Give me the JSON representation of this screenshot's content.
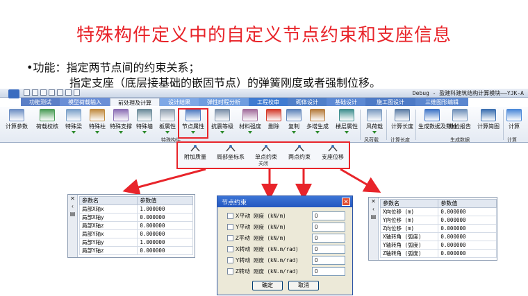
{
  "slide": {
    "title": "特殊构件定义中的自定义节点约束和支座信息",
    "bullet1": "•功能：指定两节点间的约束关系；",
    "bullet2": "指定支座（底层接基础的嵌固节点）的弹簧刚度或者强制位移。"
  },
  "app": {
    "title": "Debug - 盈建科建筑结构计算模块——YJK-A",
    "tabs": [
      {
        "label": "功能测试",
        "color": "#5b7fc7"
      },
      {
        "label": "模型荷载输入",
        "color": "#6b8fd6"
      },
      {
        "label": "前处理及计算",
        "color": "#f2f5fa",
        "active": true
      },
      {
        "label": "设计结果",
        "color": "#7fa8e6"
      },
      {
        "label": "弹性时程分析",
        "color": "#6f9de0"
      },
      {
        "label": "工程校审",
        "color": "#3f7bd1"
      },
      {
        "label": "砌体设计",
        "color": "#4f7fc9"
      },
      {
        "label": "基础设计",
        "color": "#5c89d4"
      },
      {
        "label": "施工图设计",
        "color": "#4d7ac6"
      },
      {
        "label": "三维图形编辑",
        "color": "#5a86cf"
      }
    ],
    "ribbon": [
      {
        "label": "计算参数",
        "icon": "params-icon",
        "color": "#6d8fc4"
      },
      {
        "label": "荷载校核",
        "icon": "load-check-icon",
        "color": "#4a9c57"
      },
      {
        "label": "特殊梁",
        "icon": "special-beam-icon",
        "color": "#7aa0c9"
      },
      {
        "label": "特殊柱",
        "icon": "special-column-icon",
        "color": "#c08b40"
      },
      {
        "label": "特殊支撑",
        "icon": "special-brace-icon",
        "color": "#8a6db3"
      },
      {
        "label": "特殊墙",
        "icon": "special-wall-icon",
        "color": "#6a8a99"
      },
      {
        "label": "板属性",
        "icon": "slab-icon",
        "color": "#90a0b0"
      },
      {
        "label": "节点属性",
        "icon": "node-props-icon",
        "color": "#4a78c0"
      },
      {
        "label": "抗震等级",
        "icon": "seismic-grade-icon",
        "color": "#7a8fa8"
      },
      {
        "label": "材料强度",
        "icon": "material-icon",
        "color": "#a06a9a"
      },
      {
        "label": "删除",
        "icon": "delete-icon",
        "color": "#d33a2a"
      },
      {
        "label": "复制",
        "icon": "copy-icon",
        "color": "#5d82b8"
      },
      {
        "label": "多塔生成",
        "icon": "multi-tower-icon",
        "color": "#b47a3a"
      },
      {
        "label": "楼层属性",
        "icon": "floor-props-icon",
        "color": "#3f8f8f"
      },
      {
        "label": "风荷载",
        "icon": "wind-icon",
        "color": "#7a9ac0"
      },
      {
        "label": "计算长度",
        "icon": "length-icon",
        "color": "#5c7da6"
      },
      {
        "label": "生成数据及数检",
        "icon": "generate-icon",
        "color": "#3e74c7"
      },
      {
        "label": "数检报告",
        "icon": "report-icon",
        "color": "#6d8fb8"
      },
      {
        "label": "计算简图",
        "icon": "diagram-icon",
        "color": "#3b6fb0"
      },
      {
        "label": "计算",
        "icon": "calc-icon",
        "color": "#4a88d8"
      }
    ],
    "groups": [
      "特殊构件",
      "风荷载",
      "计算长度",
      "生成数据",
      "计算"
    ],
    "dropdown": {
      "items": [
        {
          "label": "附加质量",
          "icon": "extra-mass-icon"
        },
        {
          "label": "局部坐标系",
          "icon": "local-coord-icon"
        },
        {
          "label": "单点约束",
          "icon": "single-constraint-icon"
        },
        {
          "label": "两点约束",
          "icon": "two-point-constraint-icon"
        },
        {
          "label": "支座位移",
          "icon": "support-displacement-icon"
        }
      ],
      "close": "关闭"
    }
  },
  "grid_left": {
    "headers": [
      "参数名",
      "参数值"
    ],
    "side": [
      "✕",
      "‹",
      "▤"
    ],
    "rows": [
      [
        "局部X轴x",
        "1.000000"
      ],
      [
        "局部X轴y",
        "0.000000"
      ],
      [
        "局部X轴z",
        "0.000000"
      ],
      [
        "局部Y轴x",
        "0.000000"
      ],
      [
        "局部Y轴y",
        "1.000000"
      ],
      [
        "局部Y轴z",
        "0.000000"
      ]
    ]
  },
  "grid_right": {
    "headers": [
      "参数名",
      "参数值"
    ],
    "side": [
      "✕",
      "‹",
      "▤"
    ],
    "rows": [
      [
        "X向位移 (m)",
        "0.000000"
      ],
      [
        "Y向位移 (m)",
        "0.000000"
      ],
      [
        "Z向位移 (m)",
        "0.000000"
      ],
      [
        "X轴转角 (弧度)",
        "0.000000"
      ],
      [
        "Y轴转角 (弧度)",
        "0.000000"
      ],
      [
        "Z轴转角 (弧度)",
        "0.000000"
      ]
    ]
  },
  "dialog": {
    "title": "节点约束",
    "close": "✕",
    "rows": [
      {
        "label": "X平动",
        "stiff": "刚度 (kN/m)",
        "value": "0"
      },
      {
        "label": "Y平动",
        "stiff": "刚度 (kN/m)",
        "value": "0"
      },
      {
        "label": "Z平动",
        "stiff": "刚度 (kN/m)",
        "value": "0"
      },
      {
        "label": "X转动",
        "stiff": "刚度 (kN.m/rad)",
        "value": "0"
      },
      {
        "label": "Y转动",
        "stiff": "刚度 (kN.m/rad)",
        "value": "0"
      },
      {
        "label": "Z转动",
        "stiff": "刚度 (kN.m/rad)",
        "value": "0"
      }
    ],
    "ok": "确定",
    "cancel": "取消"
  },
  "colors": {
    "accent_red": "#e8242a",
    "dialog_blue": "#2457c0"
  }
}
